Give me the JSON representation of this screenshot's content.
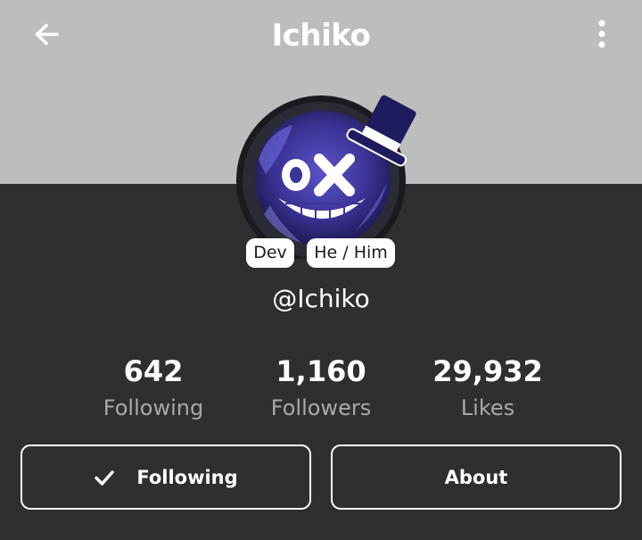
{
  "header": {
    "title": "Ichiko",
    "back_icon": "arrow-left-icon",
    "more_icon": "more-vertical-icon"
  },
  "profile": {
    "avatar_icon": "avatar-tophat-ox-face",
    "badges": [
      "Dev",
      "He / Him"
    ],
    "handle": "@Ichiko"
  },
  "stats": [
    {
      "value": "642",
      "label": "Following"
    },
    {
      "value": "1,160",
      "label": "Followers"
    },
    {
      "value": "29,932",
      "label": "Likes"
    }
  ],
  "actions": {
    "following_label": "Following",
    "following_icon": "check-icon",
    "about_label": "About"
  },
  "colors": {
    "header_bg": "#bdbdbd",
    "body_bg": "#2f2f2f",
    "text": "#ffffff",
    "muted": "#a9a9a9"
  }
}
